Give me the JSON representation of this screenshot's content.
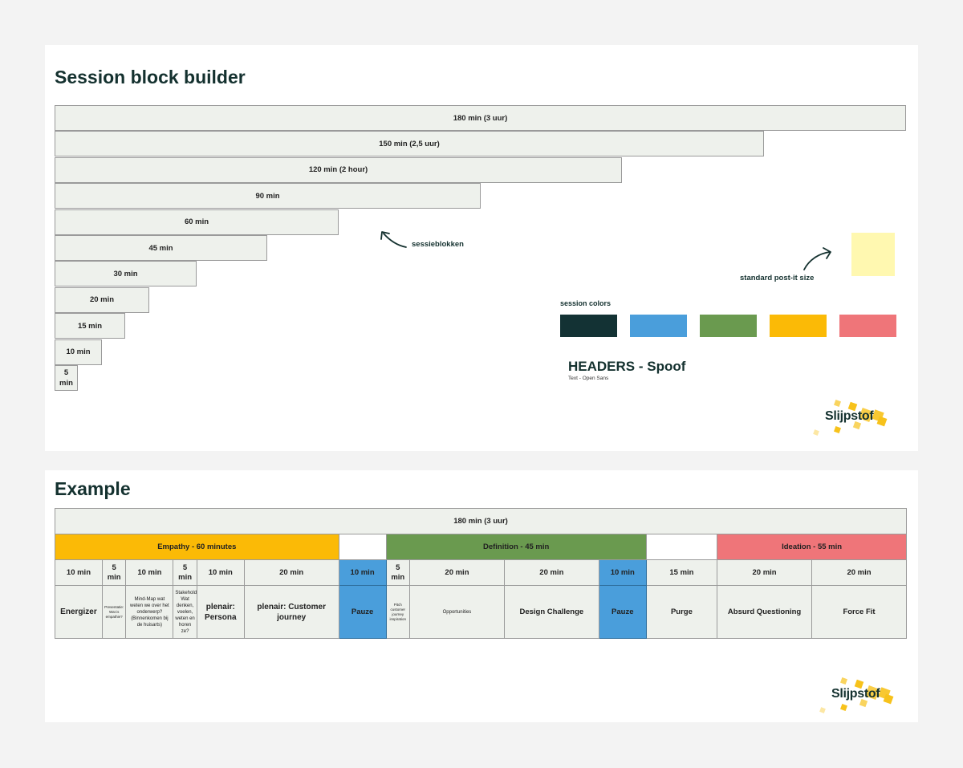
{
  "builder": {
    "title": "Session block builder",
    "blocks": [
      {
        "minutes": 180,
        "label": "180 min (3 uur)"
      },
      {
        "minutes": 150,
        "label": "150 min (2,5 uur)"
      },
      {
        "minutes": 120,
        "label": "120 min (2 hour)"
      },
      {
        "minutes": 90,
        "label": "90 min"
      },
      {
        "minutes": 60,
        "label": "60 min"
      },
      {
        "minutes": 45,
        "label": "45 min"
      },
      {
        "minutes": 30,
        "label": "30 min"
      },
      {
        "minutes": 20,
        "label": "20 min"
      },
      {
        "minutes": 15,
        "label": "15 min"
      },
      {
        "minutes": 10,
        "label": "10 min"
      },
      {
        "minutes": 5,
        "label": "5 min"
      }
    ],
    "annotation_blocks": "sessieblokken",
    "annotation_postit": "standard post-it size",
    "postit_color": "#fff8b0",
    "session_colors_label": "session colors",
    "session_colors": [
      "#133234",
      "#4a9edb",
      "#6a9a4f",
      "#fbba06",
      "#ef7579"
    ],
    "headers_title": "HEADERS - Spoof",
    "headers_subtitle": "Text - Open Sans",
    "logo_text": "Slijpstof"
  },
  "example": {
    "title": "Example",
    "total_label": "180 min (3 uur)",
    "phases": [
      {
        "label": "Empathy - 60 minutes",
        "color": "#fbba06",
        "span": 6
      },
      {
        "label": "",
        "color": "#ffffff",
        "span": 1
      },
      {
        "label": "Definition - 45 min",
        "color": "#6a9a4f",
        "span": 4
      },
      {
        "label": "",
        "color": "#ffffff",
        "span": 1
      },
      {
        "label": "Ideation - 55 min",
        "color": "#ef7579",
        "span": 3
      }
    ],
    "slots": [
      {
        "duration": "10 min",
        "activity": "Energizer",
        "style": "act"
      },
      {
        "duration": "5 min",
        "activity": "Presentatie: Wat is empathie?",
        "style": "tiny"
      },
      {
        "duration": "10 min",
        "activity": "Mind-Map wat weten we over het onderwerp? (Binnenkomen bij de huisarts)",
        "style": "small"
      },
      {
        "duration": "5 min",
        "activity": "Stakeholders: Wat denken, voelen, weten en horen ze?",
        "style": "small"
      },
      {
        "duration": "10 min",
        "activity": "plenair: Persona",
        "style": "act"
      },
      {
        "duration": "20 min",
        "activity": "plenair: Customer journey",
        "style": "act"
      },
      {
        "duration": "10 min",
        "activity": "Pauze",
        "style": "pause"
      },
      {
        "duration": "5 min",
        "activity": "Pitch customer journey inspiration",
        "style": "tiny"
      },
      {
        "duration": "20 min",
        "activity": "Opportunities",
        "style": "small"
      },
      {
        "duration": "20 min",
        "activity": "Design Challenge",
        "style": "plain"
      },
      {
        "duration": "10 min",
        "activity": "Pauze",
        "style": "pause"
      },
      {
        "duration": "15 min",
        "activity": "Purge",
        "style": "plain"
      },
      {
        "duration": "20 min",
        "activity": "Absurd Questioning",
        "style": "plain"
      },
      {
        "duration": "20 min",
        "activity": "Force Fit",
        "style": "plain"
      }
    ],
    "pause_color": "#4a9edb",
    "logo_text": "Slijpstof"
  }
}
